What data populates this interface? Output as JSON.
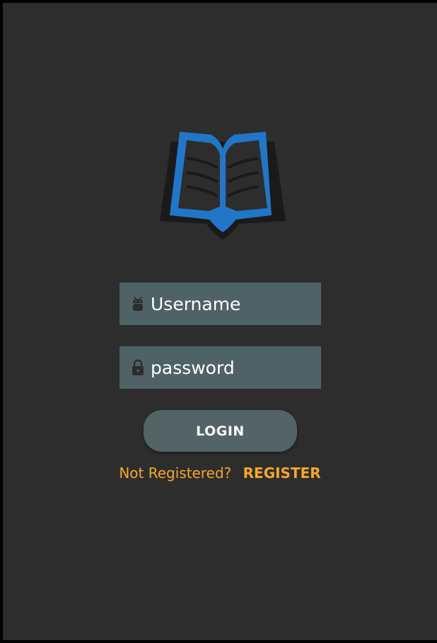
{
  "app": {
    "logo_icon": "open-book-icon",
    "accent_color": "#2176c7"
  },
  "form": {
    "username": {
      "icon": "android-icon",
      "placeholder": "Username",
      "value": ""
    },
    "password": {
      "icon": "lock-icon",
      "placeholder": "password",
      "value": ""
    },
    "login_label": "LOGIN"
  },
  "register": {
    "prompt": "Not Registered?",
    "link_label": "REGISTER",
    "color": "#f5a629"
  }
}
